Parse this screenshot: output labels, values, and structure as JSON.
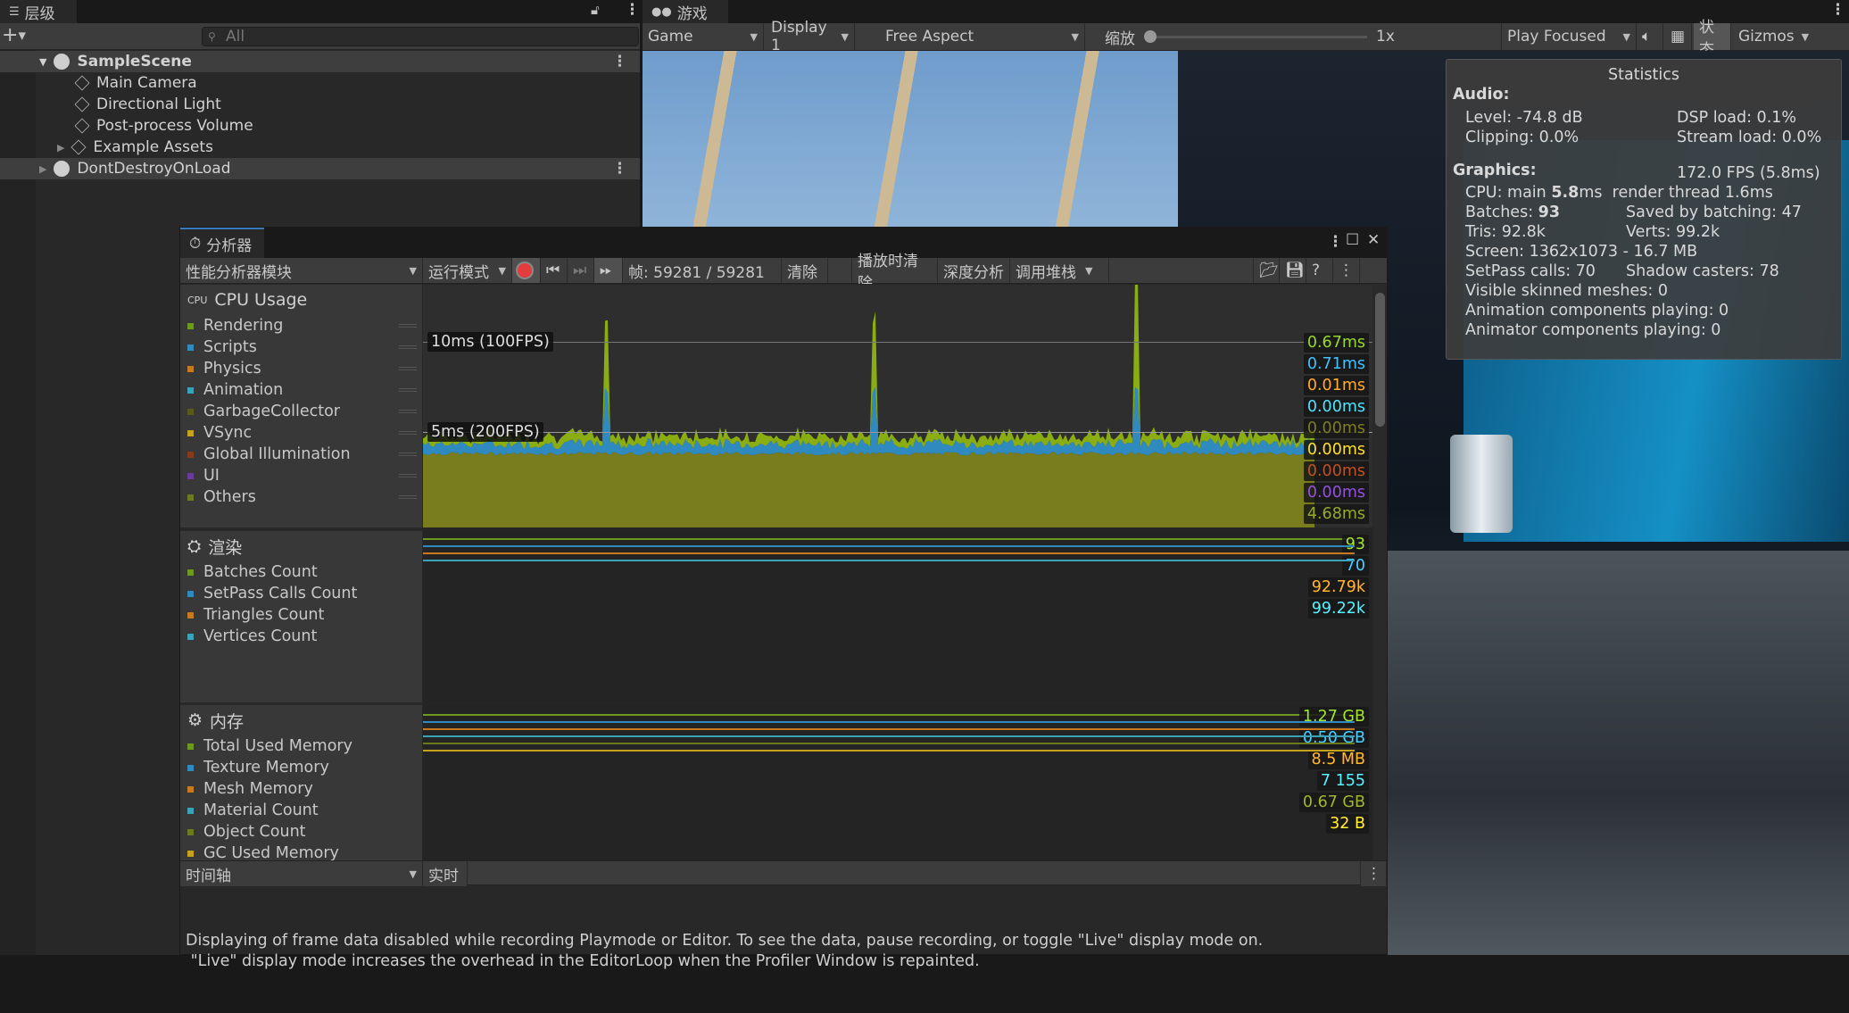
{
  "hierarchy": {
    "tab_label": "层级",
    "search_placeholder": "All",
    "items": [
      {
        "label": "SampleScene"
      },
      {
        "label": "Main Camera"
      },
      {
        "label": "Directional Light"
      },
      {
        "label": "Post-process Volume"
      },
      {
        "label": "Example Assets"
      },
      {
        "label": "DontDestroyOnLoad"
      }
    ]
  },
  "game": {
    "tab_label": "游戏",
    "view_select": "Game",
    "display_select": "Display 1",
    "aspect_select": "Free Aspect",
    "scale_label": "缩放",
    "scale_value": "1x",
    "play_mode_select": "Play Focused",
    "stats_button": "状态",
    "gizmos_button": "Gizmos"
  },
  "statistics": {
    "title": "Statistics",
    "audio_heading": "Audio:",
    "level": "Level: -74.8 dB",
    "dsp": "DSP load: 0.1%",
    "clipping": "Clipping: 0.0%",
    "stream": "Stream load: 0.0%",
    "graphics_heading": "Graphics:",
    "fps": "172.0 FPS (5.8ms)",
    "cpu_pre": "CPU: main ",
    "cpu_main": "5.8",
    "cpu_post": "ms  render thread 1.6ms",
    "batches_pre": "Batches: ",
    "batches": "93",
    "saved": "Saved by batching: 47",
    "tris": "Tris: 92.8k",
    "verts": "Verts: 99.2k",
    "screen": "Screen: 1362x1073 - 16.7 MB",
    "setpass": "SetPass calls: 70",
    "shadow": "Shadow casters: 78",
    "skinned": "Visible skinned meshes: 0",
    "anim": "Animation components playing: 0",
    "animator": "Animator components playing: 0"
  },
  "profiler": {
    "tab_label": "分析器",
    "modules_select": "性能分析器模块",
    "mode_select": "运行模式",
    "frame_label": "帧: 59281 / 59281",
    "clear": "清除",
    "clear_on_play": "播放时清除",
    "deep_profile": "深度分析",
    "call_stacks": "调用堆栈",
    "cpu": {
      "title": "CPU Usage",
      "line_10": "10ms (100FPS)",
      "line_5": "5ms (200FPS)",
      "items": [
        {
          "label": "Rendering",
          "color": "#6d9a1e",
          "value": "0.67ms"
        },
        {
          "label": "Scripts",
          "color": "#2f8bbf",
          "value": "0.71ms"
        },
        {
          "label": "Physics",
          "color": "#c87a1e",
          "value": "0.01ms"
        },
        {
          "label": "Animation",
          "color": "#3aa3b8",
          "value": "0.00ms"
        },
        {
          "label": "GarbageCollector",
          "color": "#5a5a1a",
          "value": "0.00ms"
        },
        {
          "label": "VSync",
          "color": "#c6a21c",
          "value": "0.00ms"
        },
        {
          "label": "Global Illumination",
          "color": "#8a3a1a",
          "value": "0.00ms"
        },
        {
          "label": "UI",
          "color": "#6a3aa0",
          "value": "0.00ms"
        },
        {
          "label": "Others",
          "color": "#6b7a1e",
          "value": "4.68ms"
        }
      ]
    },
    "render": {
      "title": "渲染",
      "items": [
        {
          "label": "Batches Count",
          "color": "#6d9a1e",
          "value": "93"
        },
        {
          "label": "SetPass Calls Count",
          "color": "#2f8bbf",
          "value": "70"
        },
        {
          "label": "Triangles Count",
          "color": "#c87a1e",
          "value": "92.79k"
        },
        {
          "label": "Vertices Count",
          "color": "#3aa3b8",
          "value": "99.22k"
        }
      ]
    },
    "memory": {
      "title": "内存",
      "items": [
        {
          "label": "Total Used Memory",
          "color": "#6d9a1e",
          "value": "1.27 GB"
        },
        {
          "label": "Texture Memory",
          "color": "#2f8bbf",
          "value": "0.50 GB"
        },
        {
          "label": "Mesh Memory",
          "color": "#c87a1e",
          "value": "8.5 MB"
        },
        {
          "label": "Material Count",
          "color": "#3aa3b8",
          "value": "7 155"
        },
        {
          "label": "Object Count",
          "color": "#6b7a1e",
          "value": "0.67 GB"
        },
        {
          "label": "GC Used Memory",
          "color": "#c6a21c",
          "value": "32 B"
        }
      ]
    },
    "timeline_select": "时间轴",
    "live_button": "实时",
    "message": [
      "Displaying of frame data disabled while recording Playmode or Editor. To see the data, pause recording, or toggle \"Live\" display mode on.",
      " \"Live\" display mode increases the overhead in the EditorLoop when the Profiler Window is repainted."
    ]
  }
}
